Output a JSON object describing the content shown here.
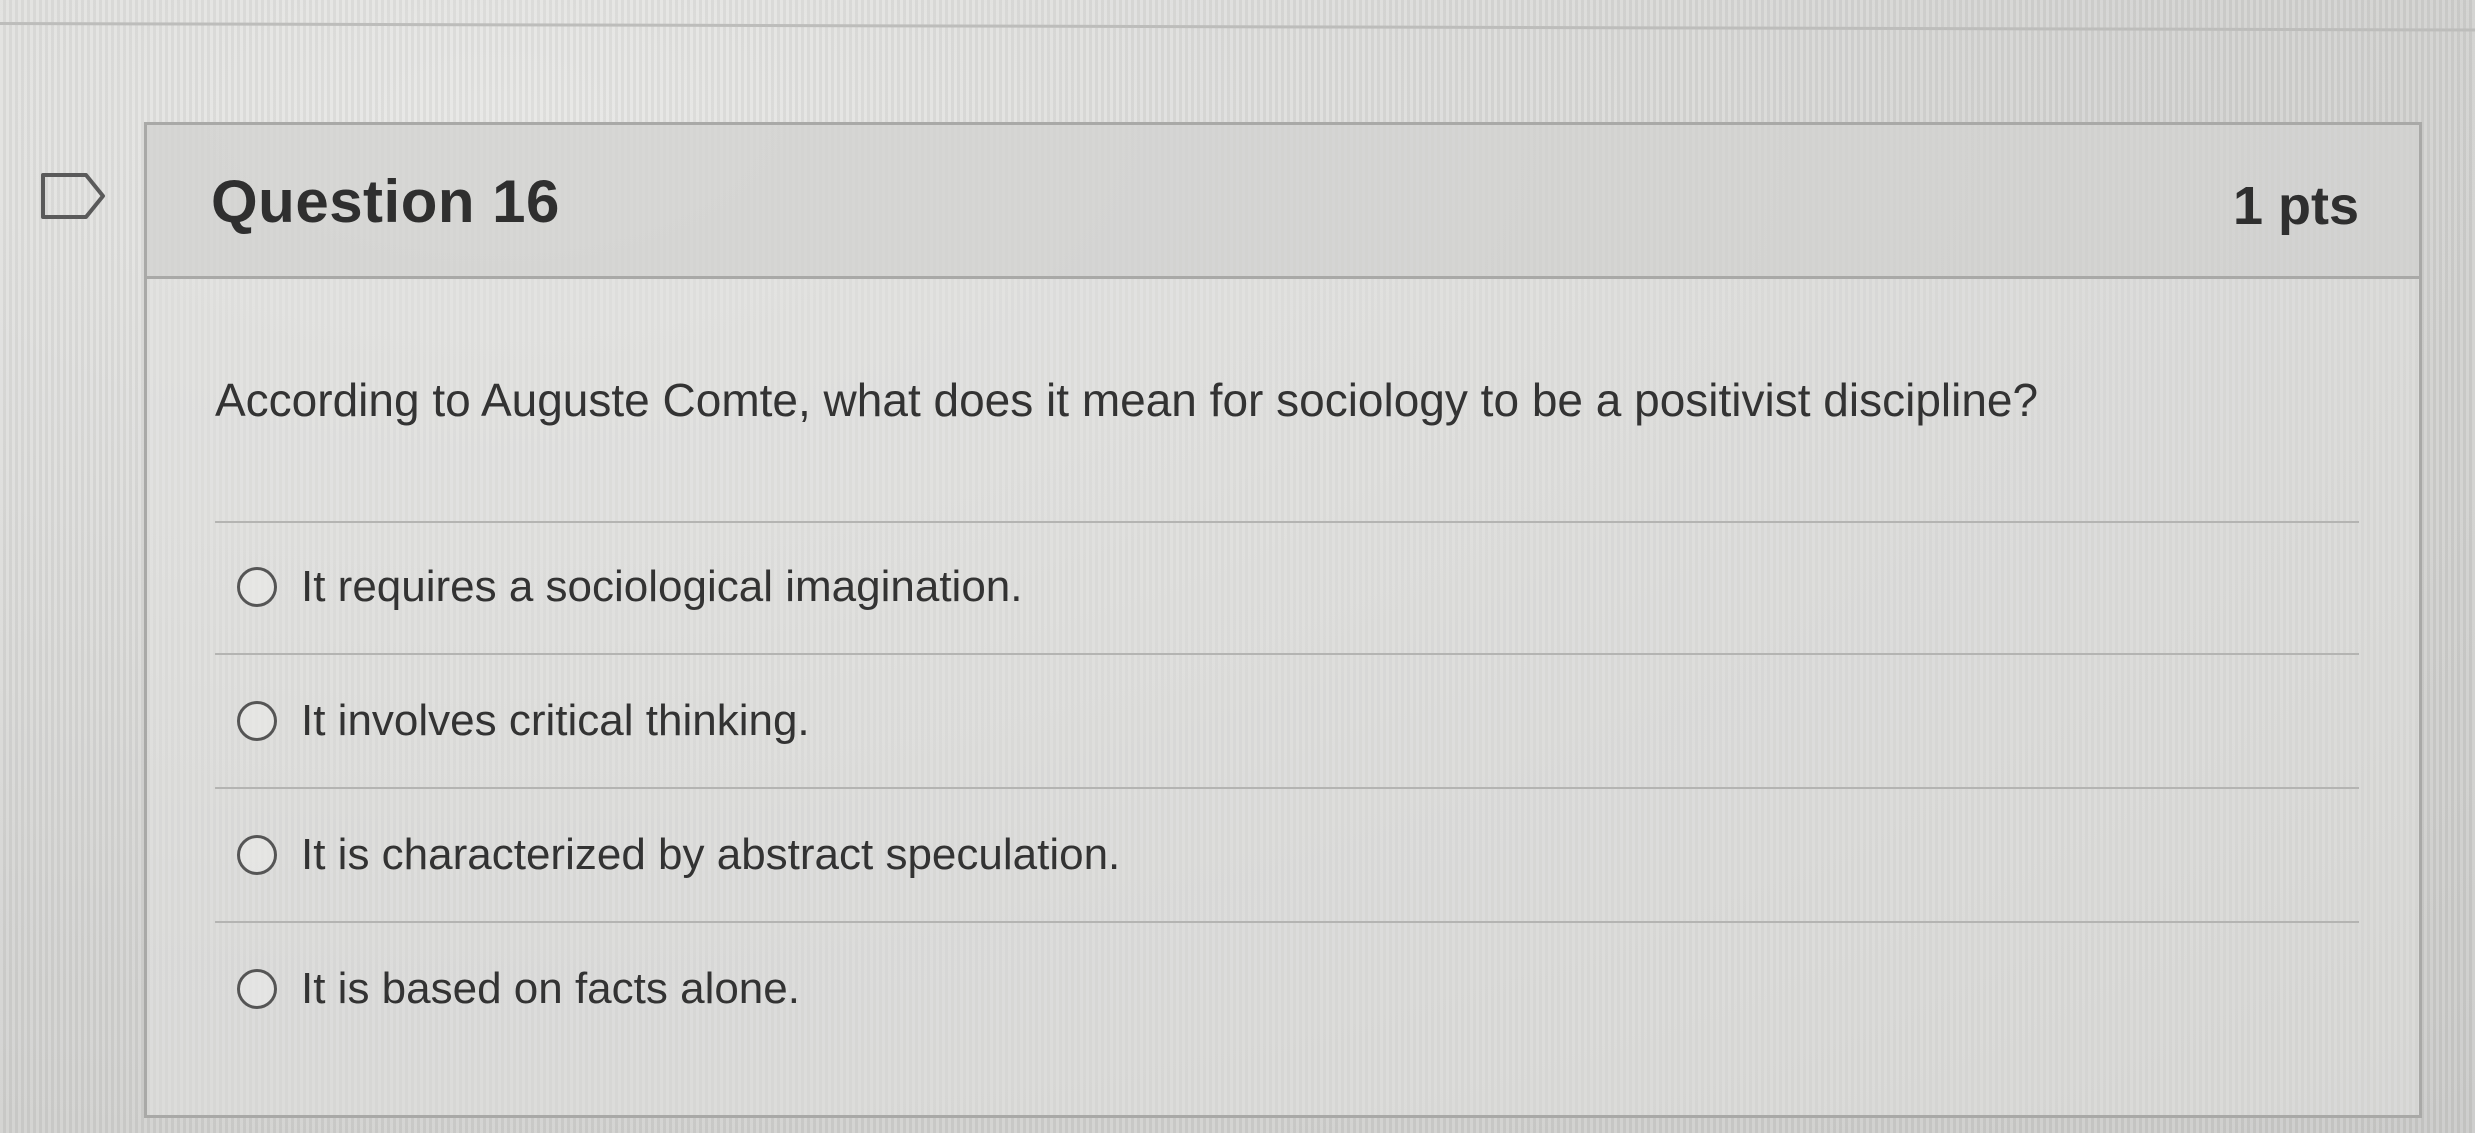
{
  "question": {
    "title": "Question 16",
    "points": "1 pts",
    "text": "According to Auguste Comte, what does it mean for sociology to be a positivist discipline?",
    "answers": [
      {
        "label": "It requires a sociological imagination.",
        "selected": false
      },
      {
        "label": "It involves critical thinking.",
        "selected": false
      },
      {
        "label": "It is characterized by abstract speculation.",
        "selected": false
      },
      {
        "label": "It is based on facts alone.",
        "selected": false
      }
    ]
  },
  "icons": {
    "flag": "flag-question-icon",
    "radio": "radio-unselected-icon"
  },
  "colors": {
    "text": "#333333",
    "border": "#a9a9a7"
  }
}
